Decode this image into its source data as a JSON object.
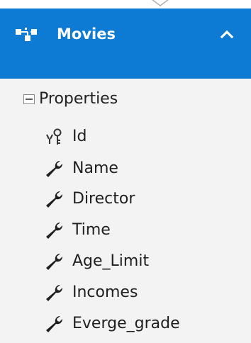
{
  "entity": {
    "title": "Movies",
    "icon": "entity-icon",
    "collapse_icon": "chevron-up-icon",
    "header_color": "#0d7ad3"
  },
  "section": {
    "label": "Properties",
    "toggle_icon": "collapse-minus-icon",
    "background": "#f3f3f3"
  },
  "properties": [
    {
      "label": "Id",
      "icon": "key-icon"
    },
    {
      "label": "Name",
      "icon": "wrench-icon"
    },
    {
      "label": "Director",
      "icon": "wrench-icon"
    },
    {
      "label": "Time",
      "icon": "wrench-icon"
    },
    {
      "label": "Age_Limit",
      "icon": "wrench-icon"
    },
    {
      "label": "Incomes",
      "icon": "wrench-icon"
    },
    {
      "label": "Everge_grade",
      "icon": "wrench-icon"
    }
  ]
}
